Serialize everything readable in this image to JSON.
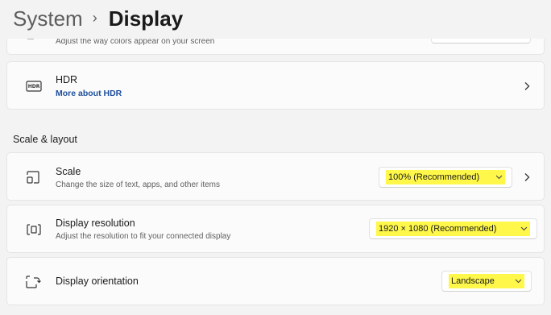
{
  "breadcrumb": {
    "parent": "System",
    "separator": "›",
    "current": "Display"
  },
  "color_profile_row": {
    "description": "Adjust the way colors appear on your screen"
  },
  "hdr_row": {
    "icon": "hdr-icon",
    "icon_text": "HDR",
    "title": "HDR",
    "link": "More about HDR"
  },
  "section": {
    "heading": "Scale & layout"
  },
  "scale_row": {
    "icon": "scale-icon",
    "title": "Scale",
    "description": "Change the size of text, apps, and other items",
    "value": "100% (Recommended)"
  },
  "resolution_row": {
    "icon": "resolution-icon",
    "title": "Display resolution",
    "description": "Adjust the resolution to fit your connected display",
    "value": "1920 × 1080 (Recommended)"
  },
  "orientation_row": {
    "icon": "orientation-icon",
    "title": "Display orientation",
    "value": "Landscape"
  },
  "colors": {
    "background": "#f3f3f3",
    "card": "#fbfbfb",
    "link": "#1e4f9c",
    "highlight": "#fff84a"
  }
}
